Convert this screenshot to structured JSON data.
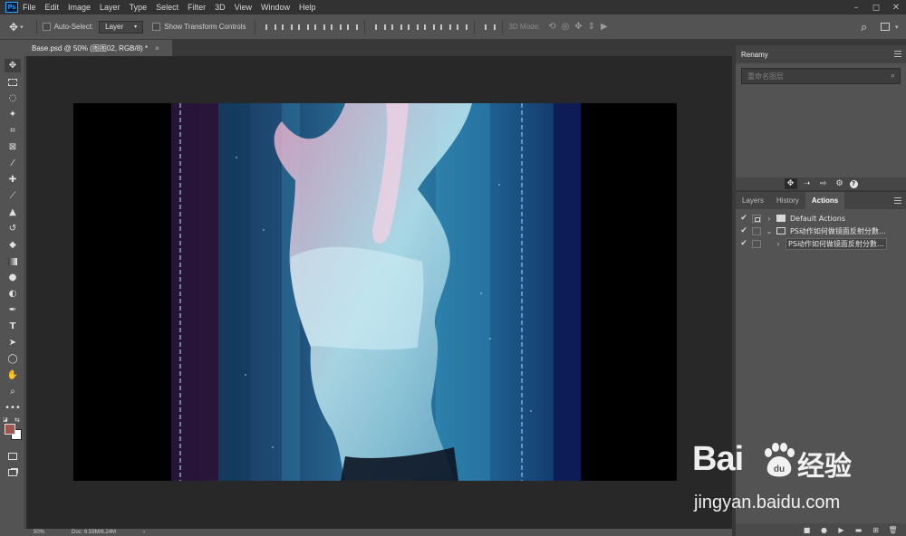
{
  "menubar": {
    "logo": "Ps",
    "items": [
      "File",
      "Edit",
      "Image",
      "Layer",
      "Type",
      "Select",
      "Filter",
      "3D",
      "View",
      "Window",
      "Help"
    ],
    "window_controls": [
      "–",
      "◻",
      "✕"
    ]
  },
  "options": {
    "auto_select_label": "Auto-Select:",
    "auto_select_value": "Layer",
    "show_transform_label": "Show Transform Controls",
    "mode_3d_label": "3D Mode:"
  },
  "document": {
    "tab_title": "Base.psd @ 50% (图图02, RGB/8) *",
    "close": "×"
  },
  "statusbar": {
    "zoom": "50%",
    "doc_info": "Doc: 6.59M/6.24M",
    "arrow": "›"
  },
  "renamy": {
    "title": "Renamy",
    "search_placeholder": "重命名图层",
    "search_icon": "⌕"
  },
  "panel_tabs": [
    {
      "label": "Layers",
      "active": false
    },
    {
      "label": "History",
      "active": false
    },
    {
      "label": "Actions",
      "active": true
    }
  ],
  "actions": {
    "rows": [
      {
        "check": "✔",
        "label": "Default Actions",
        "expander": "›",
        "dialog": true
      },
      {
        "check": "✔",
        "label": "PS动作如何做镜面反射分數…",
        "expander": "⌄",
        "dialog": false
      },
      {
        "check": "✔",
        "label": "PS动作如何做镜面反射分數…",
        "expander": "›",
        "dialog": false
      }
    ],
    "footer_icons": [
      "stop-icon",
      "record-icon",
      "play-icon",
      "new-set-icon",
      "new-action-icon",
      "delete-icon"
    ]
  },
  "watermark": {
    "brand": "Bai",
    "suffix": "经验",
    "url": "jingyan.baidu.com"
  },
  "colors": {
    "foreground": "#a15450",
    "background": "#ffffff",
    "accent": "#31a8ff"
  }
}
